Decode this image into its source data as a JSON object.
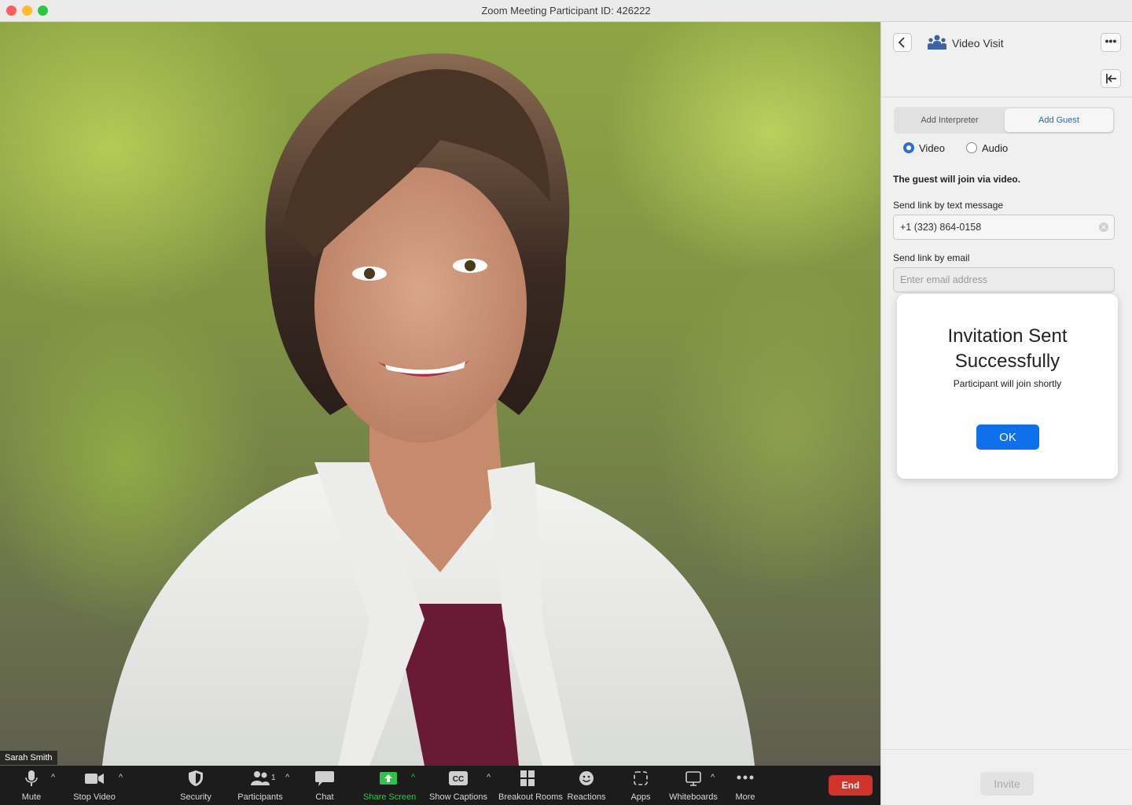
{
  "window": {
    "title": "Zoom Meeting Participant ID: 426222"
  },
  "video": {
    "participant_name": "Sarah Smith"
  },
  "toolbar": {
    "mute": "Mute",
    "stop_video": "Stop Video",
    "security": "Security",
    "participants": "Participants",
    "participants_count": "1",
    "chat": "Chat",
    "share_screen": "Share Screen",
    "show_captions": "Show Captions",
    "breakout_rooms": "Breakout Rooms",
    "reactions": "Reactions",
    "apps": "Apps",
    "whiteboards": "Whiteboards",
    "more": "More",
    "end": "End",
    "share_color": "#30c24b",
    "end_color": "#d1342a"
  },
  "panel": {
    "title": "Video Visit",
    "tabs": [
      "Add Interpreter",
      "Add Guest"
    ],
    "active_tab": "Add Guest",
    "radio_video": "Video",
    "radio_audio": "Audio",
    "selected_mode": "Video",
    "hint": "The guest will join via video.",
    "sms_label": "Send link by text message",
    "sms_value": "+1 (323) 864-0158",
    "email_label": "Send link by email",
    "email_placeholder": "Enter email address",
    "invite": "Invite"
  },
  "modal": {
    "title_line1": "Invitation Sent",
    "title_line2": "Successfully",
    "subtitle": "Participant will join shortly",
    "ok": "OK",
    "ok_color": "#0e71eb"
  }
}
